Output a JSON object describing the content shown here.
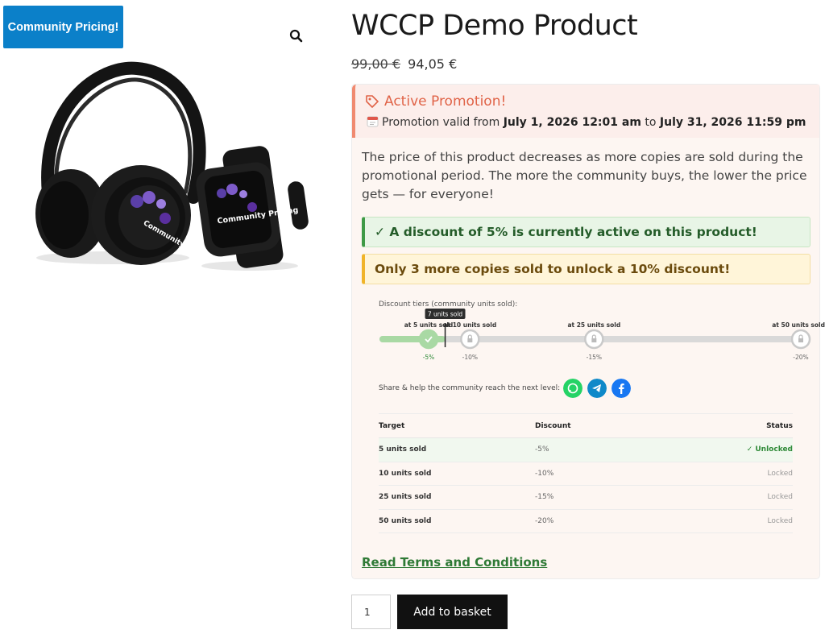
{
  "badge": {
    "label": "Community Pricing!"
  },
  "product": {
    "title": "WCCP Demo Product",
    "price_old": "99,00 €",
    "price_new": "94,05 €",
    "image_text_1": "Community Pricing",
    "image_text_2": "Community Pricing"
  },
  "promotion": {
    "title": "Active Promotion!",
    "valid_prefix": "Promotion valid from",
    "start": "July 1, 2026 12:01 am",
    "to_word": "to",
    "end": "July 31, 2026 11:59 pm",
    "description": "The price of this product decreases as more copies are sold during the promotional period. The more the community buys, the lower the price gets — for everyone!",
    "alert_active": "✓ A discount of 5% is currently active on this product!",
    "alert_next": "Only 3 more copies sold to unlock a 10% discount!"
  },
  "tiers": {
    "label": "Discount tiers (community units sold):",
    "current_units": 7,
    "current_label": "7 units sold",
    "max_units": 50,
    "items": [
      {
        "units": 5,
        "label": "at 5 units sold",
        "discount": "-5%",
        "unlocked": true
      },
      {
        "units": 10,
        "label": "at 10 units sold",
        "discount": "-10%",
        "unlocked": false
      },
      {
        "units": 25,
        "label": "at 25 units sold",
        "discount": "-15%",
        "unlocked": false
      },
      {
        "units": 50,
        "label": "at 50 units sold",
        "discount": "-20%",
        "unlocked": false
      }
    ]
  },
  "share": {
    "label": "Share & help the community reach the next level:",
    "buttons": [
      {
        "name": "whatsapp",
        "color": "#25d366"
      },
      {
        "name": "telegram",
        "color": "#0f89c9"
      },
      {
        "name": "facebook",
        "color": "#1877f2"
      }
    ]
  },
  "table": {
    "headers": {
      "target": "Target",
      "discount": "Discount",
      "status": "Status"
    },
    "rows": [
      {
        "target": "5 units sold",
        "discount": "-5%",
        "status": "✓ Unlocked"
      },
      {
        "target": "10 units sold",
        "discount": "-10%",
        "status": "Locked"
      },
      {
        "target": "25 units sold",
        "discount": "-15%",
        "status": "Locked"
      },
      {
        "target": "50 units sold",
        "discount": "-20%",
        "status": "Locked"
      }
    ]
  },
  "terms_link": "Read Terms and Conditions",
  "cart": {
    "quantity": "1",
    "add_label": "Add to basket"
  },
  "colors": {
    "accent_blue": "#0b80c9",
    "promo_orange": "#e06347",
    "success_green": "#3e9a46",
    "warning_yellow": "#f0b429"
  }
}
